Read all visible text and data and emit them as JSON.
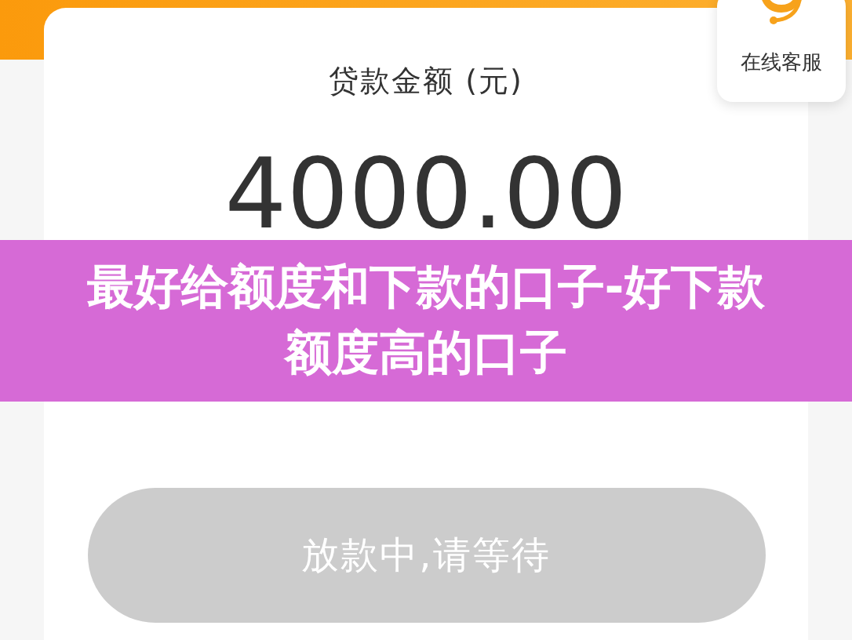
{
  "loan": {
    "label": "贷款金额 (元)",
    "amount": "4000.00"
  },
  "service": {
    "label": "在线客服"
  },
  "banner": {
    "title": "最好给额度和下款的口子-好下款额度高的口子"
  },
  "action_button": {
    "label": "放款中,请等待",
    "disabled": true
  }
}
